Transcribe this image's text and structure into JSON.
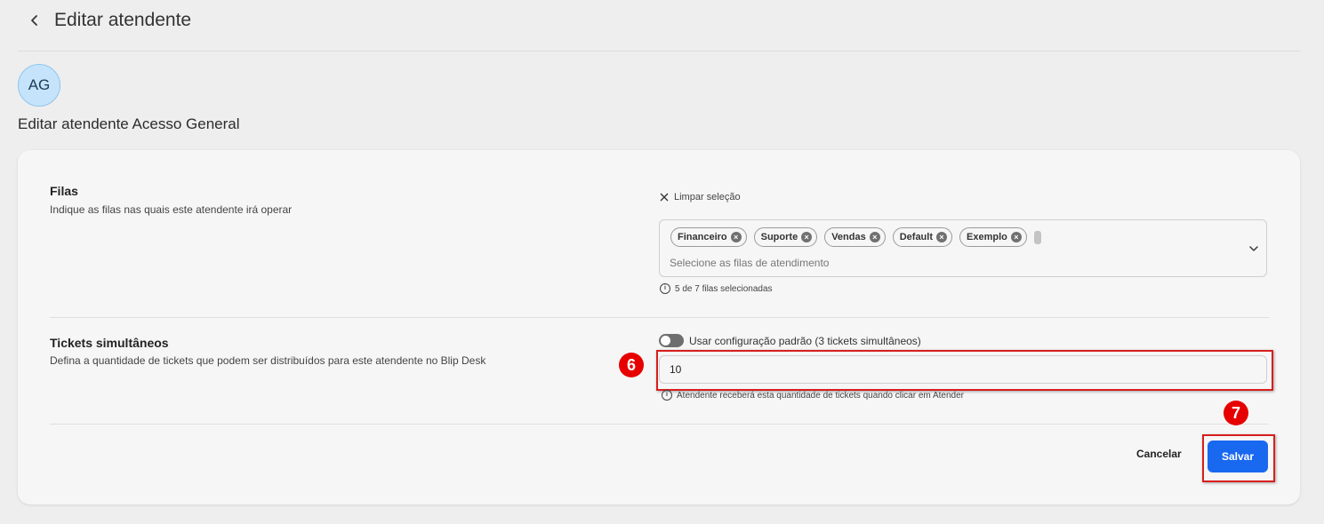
{
  "header": {
    "title": "Editar atendente"
  },
  "profile": {
    "initials": "AG",
    "subtitle": "Editar atendente Acesso General"
  },
  "queues": {
    "title": "Filas",
    "description": "Indique as filas nas quais este atendente irá operar",
    "clear_label": "Limpar seleção",
    "chips": [
      "Financeiro",
      "Suporte",
      "Vendas",
      "Default",
      "Exemplo"
    ],
    "placeholder": "Selecione as filas de atendimento",
    "helper": "5 de 7 filas selecionadas"
  },
  "tickets": {
    "title": "Tickets simultâneos",
    "description": "Defina a quantidade de tickets que podem ser distribuídos para este atendente no Blip Desk",
    "toggle_label": "Usar configuração padrão (3 tickets simultâneos)",
    "value": "10",
    "helper": "Atendente receberá esta quantidade de tickets quando clicar em Atender"
  },
  "actions": {
    "cancel": "Cancelar",
    "save": "Salvar"
  },
  "annotations": {
    "step6": "6",
    "step7": "7",
    "color": "#d81e1e"
  },
  "icons": {
    "back": "chevron-left-icon",
    "clear": "close-icon",
    "dropdown": "chevron-down-icon",
    "info": "info-icon"
  }
}
